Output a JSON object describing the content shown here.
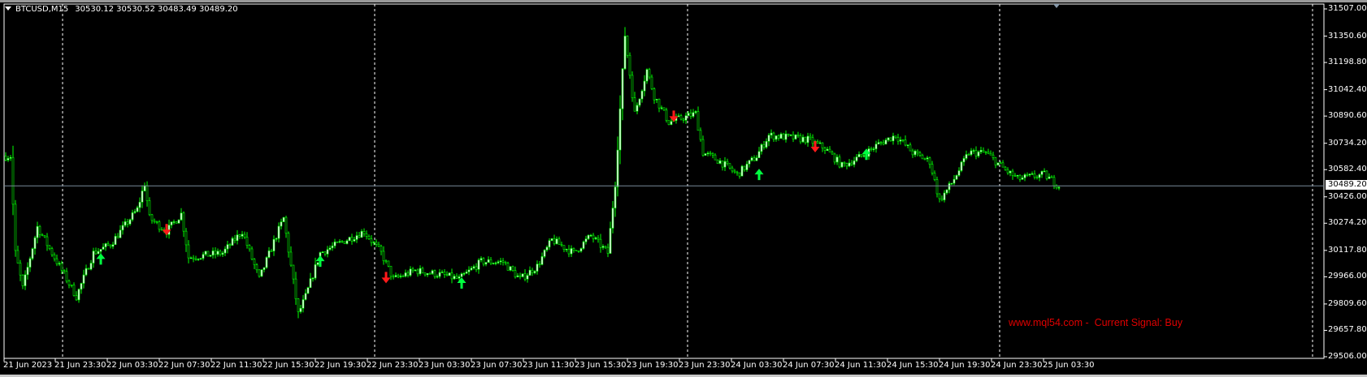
{
  "header": {
    "symbol": "BTCUSD,M15",
    "ohlc": "30530.12 30530.52 30483.49 30489.20"
  },
  "watermark": "www.mql54.com -  Current Signal: Buy",
  "colors": {
    "candle": "#00ff00",
    "bull_body": "#ffffff",
    "bear_body": "#000000",
    "down_arrow": "#ff1a1a",
    "up_arrow": "#00ff40",
    "price_line": "#778899",
    "grid": "#ffffff",
    "watermark": "#e00000"
  },
  "price_axis": {
    "labels": [
      "31507.00",
      "31350.60",
      "31198.80",
      "31042.40",
      "30890.60",
      "30734.20",
      "30582.40",
      "30426.00",
      "30274.20",
      "30117.80",
      "29966.00",
      "29809.60",
      "29657.80",
      "29506.00"
    ],
    "current_price": "30489.20"
  },
  "time_axis": {
    "labels": [
      "21 Jun 2023",
      "21 Jun 23:30",
      "22 Jun 03:30",
      "22 Jun 07:30",
      "22 Jun 11:30",
      "22 Jun 15:30",
      "22 Jun 19:30",
      "22 Jun 23:30",
      "23 Jun 03:30",
      "23 Jun 07:30",
      "23 Jun 11:30",
      "23 Jun 15:30",
      "23 Jun 19:30",
      "23 Jun 23:30",
      "24 Jun 03:30",
      "24 Jun 07:30",
      "24 Jun 11:30",
      "24 Jun 15:30",
      "24 Jun 19:30",
      "24 Jun 23:30",
      "25 Jun 03:30"
    ]
  },
  "chart_data": {
    "type": "candlestick",
    "symbol": "BTCUSD",
    "timeframe": "M15",
    "ylim": [
      29506.0,
      31507.0
    ],
    "bar_count": 433,
    "close_path": [
      [
        0,
        30660
      ],
      [
        2,
        30660
      ],
      [
        4,
        30103
      ],
      [
        7,
        29900
      ],
      [
        13,
        30253
      ],
      [
        21,
        30052
      ],
      [
        29,
        29852
      ],
      [
        36,
        30103
      ],
      [
        43,
        30153
      ],
      [
        54,
        30354
      ],
      [
        57,
        30504
      ],
      [
        59,
        30303
      ],
      [
        66,
        30228
      ],
      [
        72,
        30328
      ],
      [
        75,
        30078
      ],
      [
        89,
        30103
      ],
      [
        97,
        30228
      ],
      [
        104,
        29952
      ],
      [
        111,
        30203
      ],
      [
        114,
        30303
      ],
      [
        120,
        29751
      ],
      [
        123,
        29852
      ],
      [
        129,
        30103
      ],
      [
        136,
        30153
      ],
      [
        147,
        30228
      ],
      [
        154,
        30103
      ],
      [
        159,
        29952
      ],
      [
        168,
        30002
      ],
      [
        179,
        29977
      ],
      [
        186,
        29952
      ],
      [
        195,
        30052
      ],
      [
        204,
        30052
      ],
      [
        211,
        29952
      ],
      [
        218,
        30027
      ],
      [
        224,
        30178
      ],
      [
        233,
        30103
      ],
      [
        240,
        30203
      ],
      [
        247,
        30103
      ],
      [
        250,
        30504
      ],
      [
        254,
        31357
      ],
      [
        258,
        30905
      ],
      [
        263,
        31156
      ],
      [
        266,
        31006
      ],
      [
        272,
        30855
      ],
      [
        283,
        30905
      ],
      [
        286,
        30680
      ],
      [
        293,
        30630
      ],
      [
        300,
        30554
      ],
      [
        308,
        30660
      ],
      [
        313,
        30780
      ],
      [
        329,
        30755
      ],
      [
        336,
        30705
      ],
      [
        343,
        30604
      ],
      [
        351,
        30660
      ],
      [
        358,
        30730
      ],
      [
        365,
        30780
      ],
      [
        372,
        30680
      ],
      [
        379,
        30630
      ],
      [
        383,
        30404
      ],
      [
        388,
        30504
      ],
      [
        395,
        30680
      ],
      [
        402,
        30680
      ],
      [
        410,
        30580
      ],
      [
        415,
        30529
      ],
      [
        426,
        30554
      ],
      [
        432,
        30489
      ]
    ],
    "signals": [
      {
        "bar": 39,
        "price": 30078,
        "type": "buy"
      },
      {
        "bar": 66,
        "price": 30228,
        "type": "sell"
      },
      {
        "bar": 129,
        "price": 30065,
        "type": "buy"
      },
      {
        "bar": 156,
        "price": 29952,
        "type": "sell"
      },
      {
        "bar": 187,
        "price": 29940,
        "type": "buy"
      },
      {
        "bar": 274,
        "price": 30880,
        "type": "sell"
      },
      {
        "bar": 309,
        "price": 30564,
        "type": "buy"
      },
      {
        "bar": 332,
        "price": 30705,
        "type": "sell"
      },
      {
        "bar": 353,
        "price": 30680,
        "type": "buy"
      }
    ]
  }
}
